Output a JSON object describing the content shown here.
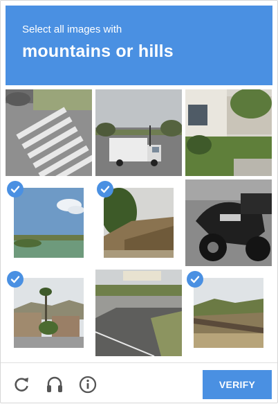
{
  "header": {
    "instruction": "Select all images with",
    "target": "mountains or hills",
    "color": "#4a90e2"
  },
  "grid": {
    "tiles": [
      {
        "name": "tile-crosswalk",
        "selected": false
      },
      {
        "name": "tile-truck-intersection",
        "selected": false
      },
      {
        "name": "tile-house-lawn",
        "selected": false
      },
      {
        "name": "tile-lake-sky",
        "selected": true
      },
      {
        "name": "tile-tree-hillside",
        "selected": true
      },
      {
        "name": "tile-motorcycle",
        "selected": false
      },
      {
        "name": "tile-palm-town-hills",
        "selected": true
      },
      {
        "name": "tile-road-intersection",
        "selected": false
      },
      {
        "name": "tile-hill-fence",
        "selected": true
      }
    ]
  },
  "footer": {
    "icons": [
      "reload-icon",
      "audio-icon",
      "info-icon"
    ],
    "verify_label": "VERIFY"
  }
}
